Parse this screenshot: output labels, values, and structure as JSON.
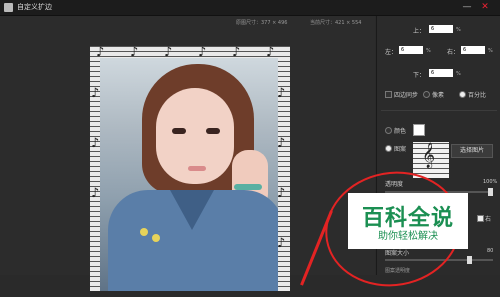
{
  "window": {
    "title": "自定义扩边",
    "minimize": "—",
    "close": "✕"
  },
  "canvas": {
    "original_size": "原图尺寸：377 × 496",
    "current_size": "当前尺寸：421 × 554",
    "note_glyph": "♪"
  },
  "settings": {
    "top_label": "上：",
    "top_value": "6",
    "left_label": "左：",
    "left_value": "6",
    "right_label": "右：",
    "right_value": "6",
    "bottom_label": "下：",
    "bottom_value": "6",
    "percent": "%",
    "sync_label": "四边同步",
    "pixel_label": "像素",
    "percent_label": "百分比",
    "color_label": "颜色",
    "pattern_label": "图案",
    "choose_image": "选择图片",
    "opacity_label": "透明度",
    "opacity_value": "100%",
    "opacity_percent": 100,
    "check_right": "右",
    "size_label": "图案大小",
    "size_value": "80",
    "size_level": 0.8,
    "bottom_partial": "图案透明度"
  },
  "overlay": {
    "title": "百科全说",
    "subtitle": "助你轻松解决"
  },
  "colors": {
    "accent_green": "#1b8f52",
    "annotation_red": "#e32323"
  },
  "icons": {
    "app": "app-icon",
    "clef": "music-clef-icon"
  }
}
